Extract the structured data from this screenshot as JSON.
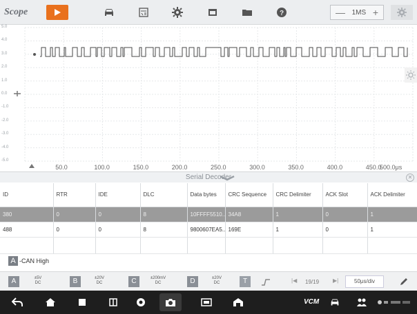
{
  "app": {
    "logo": "Scope"
  },
  "toolbar": {
    "play_icon": "play-icon",
    "icons": [
      "car-icon",
      "calculator-icon",
      "gear-icon",
      "window-icon",
      "folder-icon",
      "help-icon"
    ],
    "timebase": {
      "minus": "—",
      "value": "1MS",
      "plus": "+"
    },
    "settings_icon": "settings-gear-icon"
  },
  "plot": {
    "y_ticks": [
      "5.0",
      "4.0",
      "3.0",
      "2.0",
      "1.0",
      "0.0",
      "-1.0",
      "-2.0",
      "-3.0",
      "-4.0",
      "-5.0"
    ],
    "x_ticks": [
      "50.0",
      "100.0",
      "150.0",
      "200.0",
      "250.0",
      "300.0",
      "350.0",
      "400.0",
      "450.0",
      "500.0μs"
    ],
    "trace_color": "#4a4a4a",
    "grid_color": "#e6e8ea"
  },
  "decoder": {
    "title": "Serial Decoder",
    "columns": [
      "ID",
      "RTR",
      "IDE",
      "DLC",
      "Data bytes",
      "CRC Sequence",
      "CRC Delimiter",
      "ACK Slot",
      "ACK Delimiter"
    ],
    "rows": [
      {
        "id": "380",
        "rtr": "0",
        "ide": "0",
        "dlc": "8",
        "data": "10FFFF5510...",
        "crc_seq": "34A8",
        "crc_del": "1",
        "ack_slot": "0",
        "ack_del": "1",
        "selected": true
      },
      {
        "id": "488",
        "rtr": "0",
        "ide": "0",
        "dlc": "8",
        "data": "9800607EA5...",
        "crc_seq": "169E",
        "crc_del": "1",
        "ack_slot": "0",
        "ack_del": "1",
        "selected": false
      }
    ]
  },
  "channel_label": {
    "letter": "A",
    "text": "-CAN High"
  },
  "channels": [
    {
      "letter": "A",
      "range": "±5V",
      "coupling": "DC"
    },
    {
      "letter": "B",
      "range": "±20V",
      "coupling": "DC"
    },
    {
      "letter": "C",
      "range": "±200mV",
      "coupling": "DC"
    },
    {
      "letter": "D",
      "range": "±20V",
      "coupling": "DC"
    }
  ],
  "bottom_controls": {
    "trigger": "T",
    "page": "19/19",
    "timediv": "50μs/div"
  },
  "colors": {
    "accent": "#e9711e",
    "selected_row": "#9b9b9b",
    "nav_bg": "#1e1e1e"
  }
}
